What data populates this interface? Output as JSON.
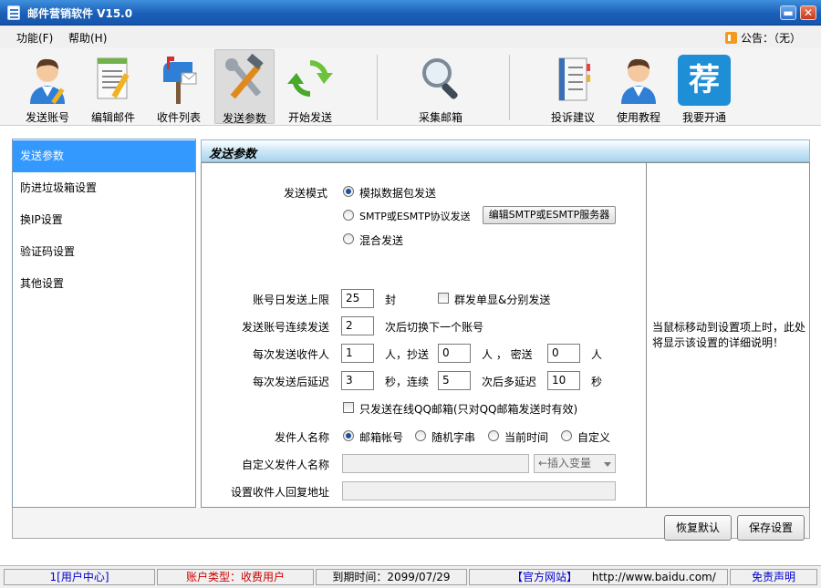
{
  "window": {
    "title": "邮件营销软件  V15.0",
    "minimize": "▬",
    "close": "✕"
  },
  "menu": {
    "items": [
      "功能(F)",
      "帮助(H)"
    ],
    "notice": "公告：（无）"
  },
  "toolbar": {
    "items": [
      {
        "label": "发送账号",
        "icon": "user-edit-icon"
      },
      {
        "label": "编辑邮件",
        "icon": "document-edit-icon"
      },
      {
        "label": "收件列表",
        "icon": "mailbox-icon"
      },
      {
        "label": "发送参数",
        "icon": "tools-icon"
      },
      {
        "label": "开始发送",
        "icon": "refresh-icon"
      },
      {
        "label": "采集邮箱",
        "icon": "magnifier-icon"
      },
      {
        "label": "投诉建议",
        "icon": "notebook-icon"
      },
      {
        "label": "使用教程",
        "icon": "user-help-icon"
      },
      {
        "label": "我要开通",
        "icon": "recommend-icon"
      }
    ],
    "recommend_glyph": "荐"
  },
  "nav": {
    "items": [
      "发送参数",
      "防进垃圾箱设置",
      "换IP设置",
      "验证码设置",
      "其他设置"
    ]
  },
  "panel": {
    "title": "发送参数",
    "send_mode_label": "发送模式",
    "mode_options": [
      "模拟数据包发送",
      "SMTP或ESMTP协议发送",
      "混合发送"
    ],
    "edit_smtp_button": "编辑SMTP或ESMTP服务器",
    "daily_limit_label": "账号日发送上限",
    "daily_limit_value": "25",
    "daily_limit_unit": "封",
    "group_send_label": "群发单显&分别发送",
    "continuous_label": "发送账号连续发送",
    "continuous_value": "2",
    "continuous_suffix": "次后切换下一个账号",
    "recipients_label": "每次发送收件人",
    "recipients_value": "1",
    "recipients_unit": "人，抄送",
    "cc_value": "0",
    "cc_unit": "人 ，  密送",
    "bcc_value": "0",
    "bcc_unit": "人",
    "delay_label": "每次发送后延迟",
    "delay_value": "3",
    "delay_unit": "秒，连续",
    "delay_count_value": "5",
    "delay_count_suffix": "次后多延迟",
    "extra_delay_value": "10",
    "extra_delay_unit": "秒",
    "qq_only_label": "只发送在线QQ邮箱(只对QQ邮箱发送时有效)",
    "sender_name_label": "发件人名称",
    "sender_options": [
      "邮箱帐号",
      "随机字串",
      "当前时间",
      "自定义"
    ],
    "custom_sender_label": "自定义发件人名称",
    "custom_sender_value": "",
    "insert_var": "←插入变量",
    "reply_label": "设置收件人回复地址",
    "reply_value": "",
    "help_text": "当鼠标移动到设置项上时，此处将显示该设置的详细说明！"
  },
  "buttons": {
    "default": "恢复默认",
    "save": "保存设置"
  },
  "status": {
    "user_center": "1[用户中心]",
    "account_type": "账户类型：收费用户",
    "expiry": "到期时间：2099/07/29",
    "official_site": "【官方网站】",
    "url": "http://www.baidu.com/",
    "disclaimer": "免责声明"
  },
  "colors": {
    "title_blue": "#1a5fb8",
    "selection": "#3399ff",
    "status_red": "#cc0000",
    "link_blue": "#0000cc"
  }
}
